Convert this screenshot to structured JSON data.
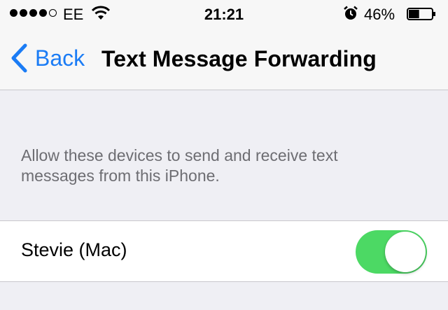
{
  "status_bar": {
    "carrier": "EE",
    "time": "21:21",
    "battery_percent": "46%",
    "battery_level": 0.46,
    "signal_bars_filled": 4,
    "signal_bars_total": 5
  },
  "nav": {
    "back_label": "Back",
    "title": "Text Message Forwarding"
  },
  "section": {
    "footer": "Allow these devices to send and receive text messages from this iPhone."
  },
  "devices": [
    {
      "label": "Stevie (Mac)",
      "enabled": true
    }
  ],
  "colors": {
    "accent": "#1b7cf5",
    "toggle_on": "#4cd964",
    "background": "#efeff4"
  },
  "icons": [
    "wifi-icon",
    "alarm-icon",
    "battery-icon",
    "back-chevron-icon"
  ]
}
